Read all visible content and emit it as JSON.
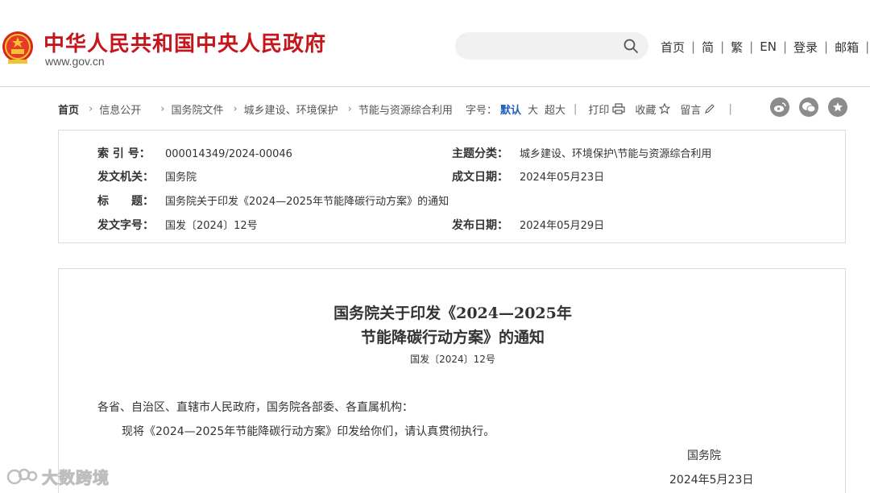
{
  "header": {
    "site_title": "中华人民共和国中央人民政府",
    "site_url": "www.gov.cn",
    "search_placeholder": "",
    "nav": [
      "首页",
      "简",
      "繁",
      "EN",
      "登录",
      "邮箱"
    ]
  },
  "breadcrumb": {
    "home": "首页",
    "items": [
      "信息公开",
      "国务院文件",
      "城乡建设、环境保护",
      "节能与资源综合利用"
    ]
  },
  "toolbar": {
    "font_label": "字号：",
    "font_current": "默认",
    "font_large": "大",
    "font_xlarge": "超大",
    "print": "打印",
    "favorite": "收藏",
    "comment": "留言"
  },
  "info": {
    "index_label": "索 引 号：",
    "index_value": "000014349/2024-00046",
    "topic_label": "主题分类：",
    "topic_value": "城乡建设、环境保护\\节能与资源综合利用",
    "issuer_label": "发文机关：",
    "issuer_value": "国务院",
    "written_label": "成文日期：",
    "written_value": "2024年05月23日",
    "title_label": "标　　题：",
    "title_value": "国务院关于印发《2024—2025年节能降碳行动方案》的通知",
    "docno_label": "发文字号：",
    "docno_value": "国发〔2024〕12号",
    "pubdate_label": "发布日期：",
    "pubdate_value": "2024年05月29日"
  },
  "article": {
    "title_line1": "国务院关于印发《2024—2025年",
    "title_line2": "节能降碳行动方案》的通知",
    "doc_number": "国发〔2024〕12号",
    "salutation": "各省、自治区、直辖市人民政府，国务院各部委、各直属机构：",
    "body": "现将《2024—2025年节能降碳行动方案》印发给你们，请认真贯彻执行。",
    "signer": "国务院",
    "date": "2024年5月23日"
  },
  "watermark": {
    "text": "大数跨境"
  },
  "colors": {
    "brand_red": "#c4161c",
    "link_blue": "#1d5cb8",
    "border_gray": "#dcdcdc"
  }
}
